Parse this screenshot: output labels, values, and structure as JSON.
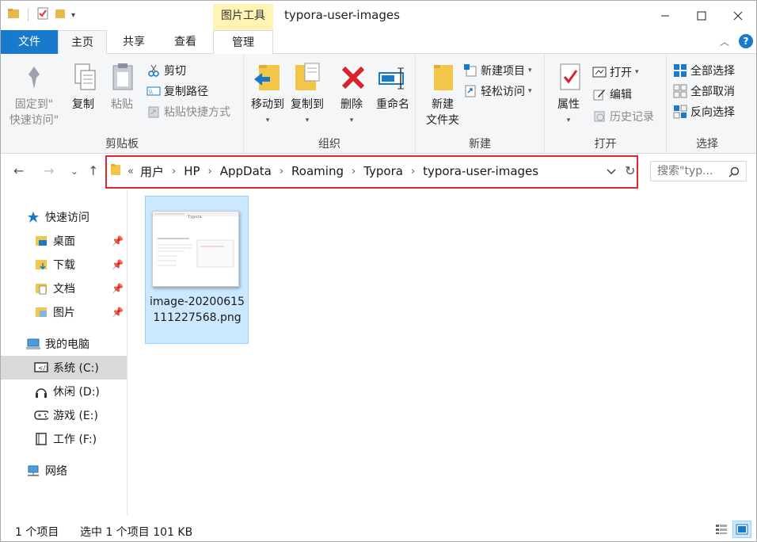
{
  "window": {
    "title": "typora-user-images",
    "context_tab_group": "图片工具"
  },
  "tabs": {
    "file": "文件",
    "home": "主页",
    "share": "共享",
    "view": "查看",
    "manage": "管理"
  },
  "ribbon": {
    "clipboard": {
      "label": "剪贴板",
      "pin_quick_access": "固定到\"\n快速访问\"",
      "pin_line1": "固定到\"",
      "pin_line2": "快速访问\"",
      "copy": "复制",
      "paste": "粘贴",
      "cut": "剪切",
      "copy_path": "复制路径",
      "paste_shortcut": "粘贴快捷方式"
    },
    "organize": {
      "label": "组织",
      "move_to": "移动到",
      "copy_to": "复制到",
      "delete": "删除",
      "rename": "重命名"
    },
    "new": {
      "label": "新建",
      "new_folder_line1": "新建",
      "new_folder_line2": "文件夹",
      "new_item": "新建项目",
      "easy_access": "轻松访问"
    },
    "open": {
      "label": "打开",
      "properties": "属性",
      "open": "打开",
      "edit": "编辑",
      "history": "历史记录"
    },
    "select": {
      "label": "选择",
      "select_all": "全部选择",
      "select_none": "全部取消",
      "invert": "反向选择"
    }
  },
  "address": {
    "overflow": "«",
    "crumbs": [
      "用户",
      "HP",
      "AppData",
      "Roaming",
      "Typora",
      "typora-user-images"
    ],
    "search_placeholder": "搜索\"typ..."
  },
  "navpane": {
    "quick_access": "快速访问",
    "desktop": "桌面",
    "downloads": "下载",
    "documents": "文档",
    "pictures": "图片",
    "this_pc": "我的电脑",
    "drive_c": "系统 (C:)",
    "drive_d": "休闲 (D:)",
    "drive_e": "游戏 (E:)",
    "drive_f": "工作 (F:)",
    "network": "网络"
  },
  "files": [
    {
      "name": "image-20200615111227568.png",
      "selected": true
    }
  ],
  "status": {
    "count": "1 个项目",
    "selection": "选中 1 个项目  101 KB"
  },
  "colors": {
    "file_tab": "#1979ca",
    "context_tab": "#fff3b5",
    "selection": "#cce8ff",
    "highlight_box": "#e0262d"
  }
}
